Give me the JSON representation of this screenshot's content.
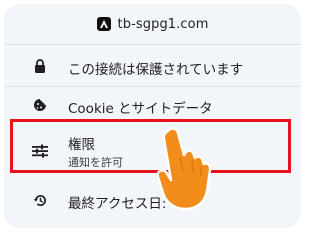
{
  "header": {
    "site": "tb-sgpg1.com",
    "favicon": "a-logo-icon"
  },
  "rows": [
    {
      "label": "この接続は保護されています",
      "icon": "lock-icon"
    },
    {
      "label": "Cookie とサイトデータ",
      "icon": "cookie-icon"
    },
    {
      "label": "権限",
      "sublabel": "通知を許可",
      "icon": "sliders-icon"
    },
    {
      "label": "最終アクセス日: 今",
      "icon": "history-icon"
    }
  ],
  "colors": {
    "panel": "#f2f5f9",
    "highlight": "#e8121a",
    "hand": "#f28c1b"
  }
}
